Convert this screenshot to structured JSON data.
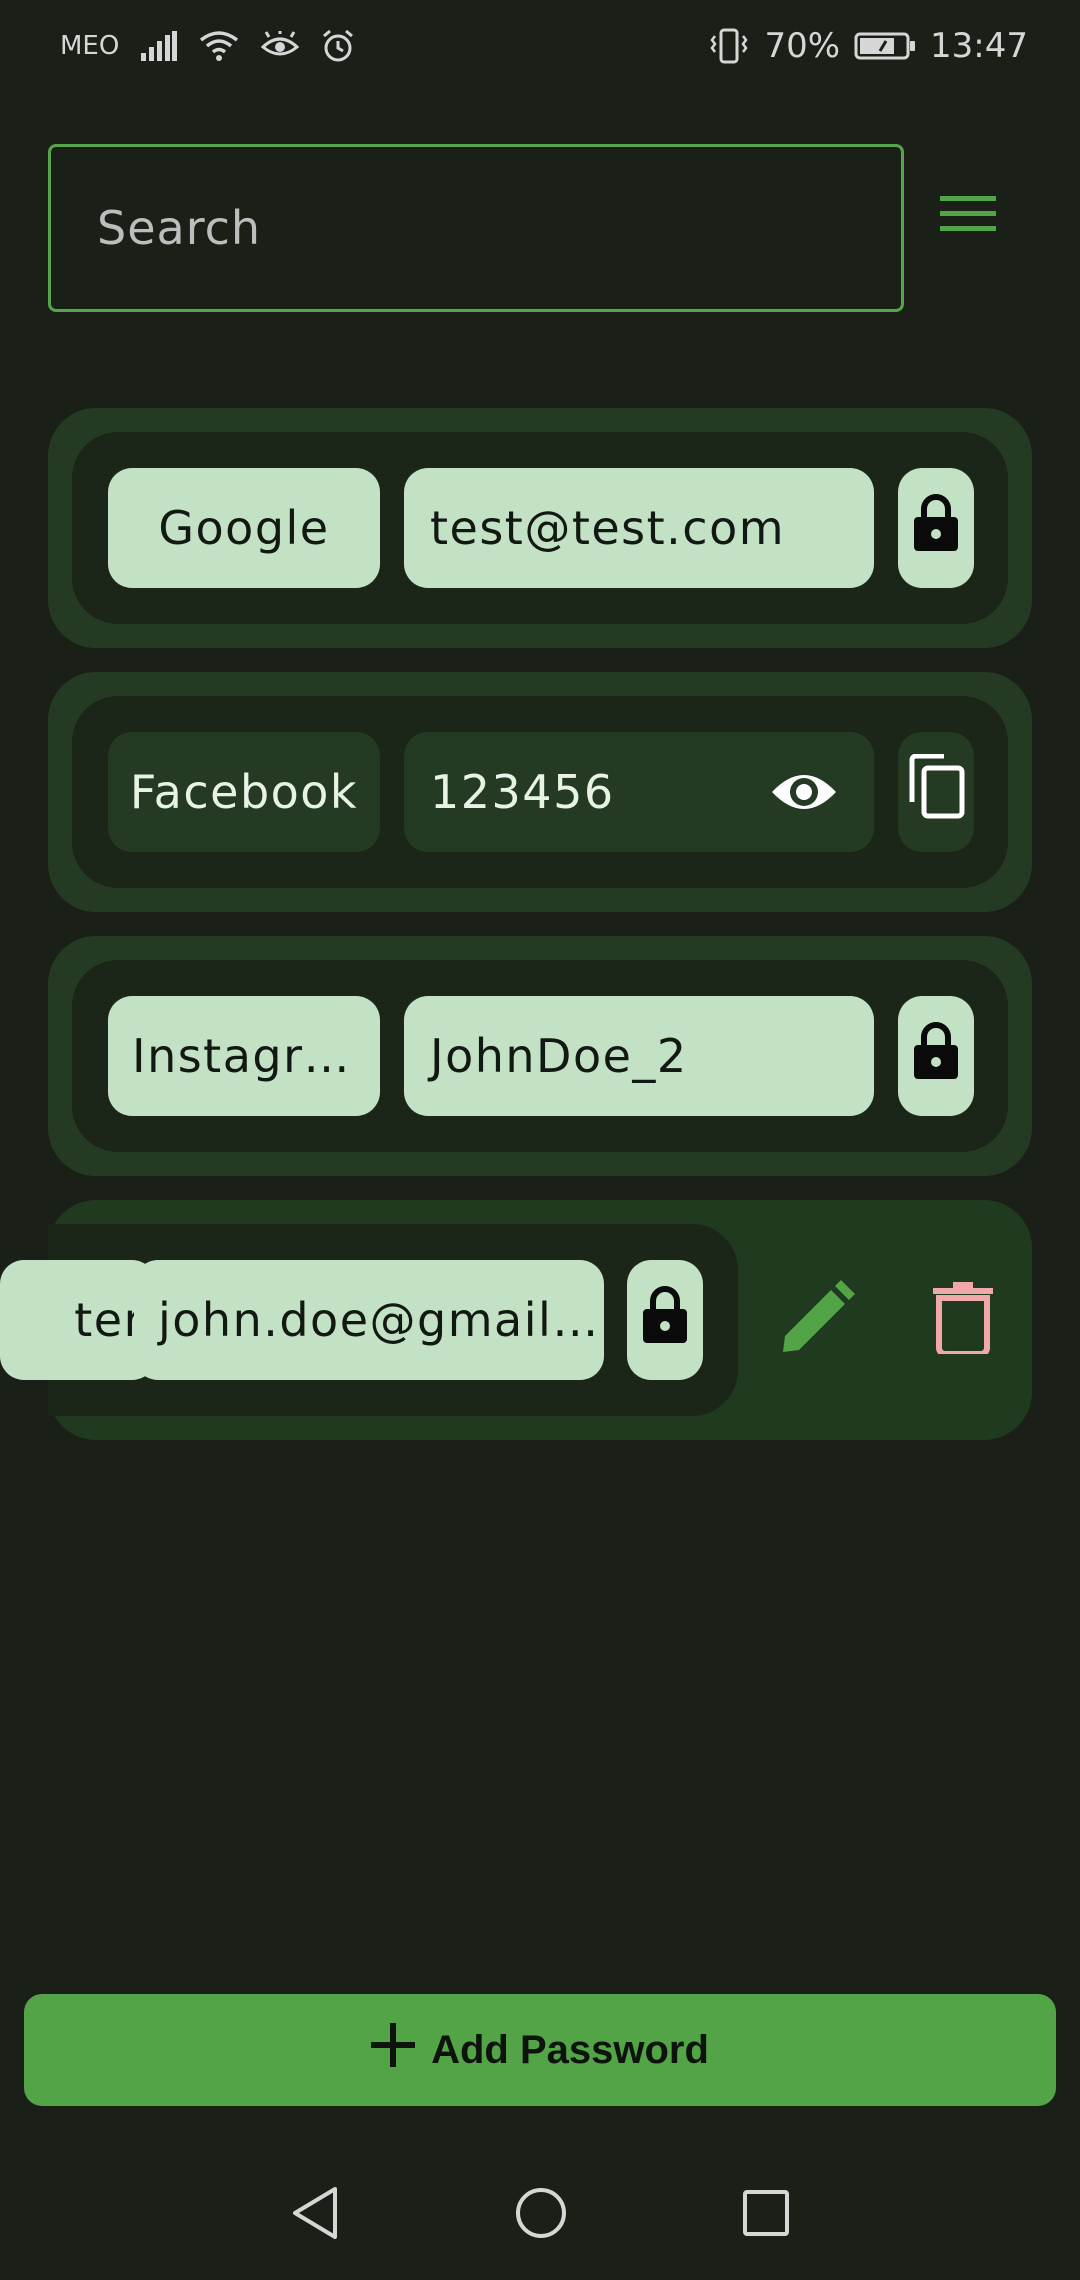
{
  "status_bar": {
    "carrier": "MEO",
    "battery": "70%",
    "time": "13:47"
  },
  "search": {
    "placeholder": "Search"
  },
  "entries": [
    {
      "name": "Google",
      "value": "test@test.com",
      "state": "hidden",
      "action_icon": "lock-icon"
    },
    {
      "name": "Facebook",
      "value": "123456",
      "state": "revealed",
      "action_icon": "copy-icon"
    },
    {
      "name": "Instagr…",
      "value": "JohnDoe_2",
      "state": "hidden",
      "action_icon": "lock-icon"
    },
    {
      "name": "ter",
      "value": "john.doe@gmail…",
      "state": "swiped",
      "action_icon": "lock-icon"
    }
  ],
  "add_button": {
    "label": "Add Password"
  },
  "colors": {
    "background": "#1a1f18",
    "accent": "#53a447",
    "card_outer": "#243a22",
    "pill_light": "#c3e2c5",
    "delete": "#f0a8a8"
  },
  "icons": {
    "menu": "hamburger-menu-icon",
    "edit": "pencil-icon",
    "delete": "trash-icon",
    "reveal": "eye-icon",
    "add": "plus-icon"
  }
}
